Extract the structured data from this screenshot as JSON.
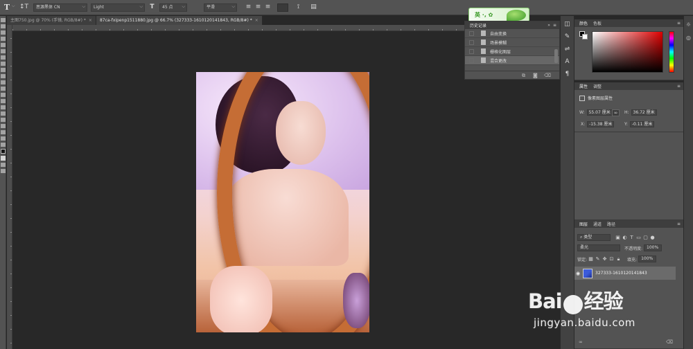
{
  "options_bar": {
    "tool_glyph": "T",
    "orient_glyph": "↕T",
    "font_family": "思源黑体 CN",
    "font_style": "Light",
    "size_glyph": "T",
    "font_size": "45 点",
    "aa_mode": "平滑"
  },
  "tabs": [
    {
      "label": "主图750.jpg @ 70% (手镜, RGB/8#) *",
      "close": "×"
    },
    {
      "label": "87ca-fxipenp1511880.jpg @ 66.7% (327333-1610120141843, RGB/8#) *",
      "close": "×"
    }
  ],
  "ime": {
    "label": "英 ·, ✿"
  },
  "history": {
    "tabs": [
      "历史记录"
    ],
    "collapse": "»",
    "items": [
      "自由变换",
      "场景模糊",
      "栅格化图层",
      "混合更改"
    ],
    "selected_index": 3
  },
  "color": {
    "tabs": [
      "颜色",
      "色板"
    ],
    "fg_color": "#000000",
    "bg_color": "#ffffff"
  },
  "properties": {
    "tabs": [
      "属性",
      "调整"
    ],
    "title": "像素图层属性",
    "w_label": "W:",
    "w_value": "55.07 厘米",
    "link_glyph": "∞",
    "h_label": "H:",
    "h_value": "36.72 厘米",
    "x_label": "X:",
    "x_value": "-15.38 厘米",
    "y_label": "Y:",
    "y_value": "-0.11 厘米"
  },
  "layers": {
    "tabs": [
      "图层",
      "通道",
      "路径"
    ],
    "filter_type": "类型",
    "blend_mode": "柔光",
    "opacity_label": "不透明度:",
    "opacity_value": "100%",
    "lock_label": "锁定:",
    "fill_label": "填充:",
    "fill_value": "100%",
    "layer_name": "327333-1610120141843"
  },
  "watermark": {
    "logo_left": "Bai",
    "logo_right": "经验",
    "url": "jingyan.baidu.com"
  }
}
